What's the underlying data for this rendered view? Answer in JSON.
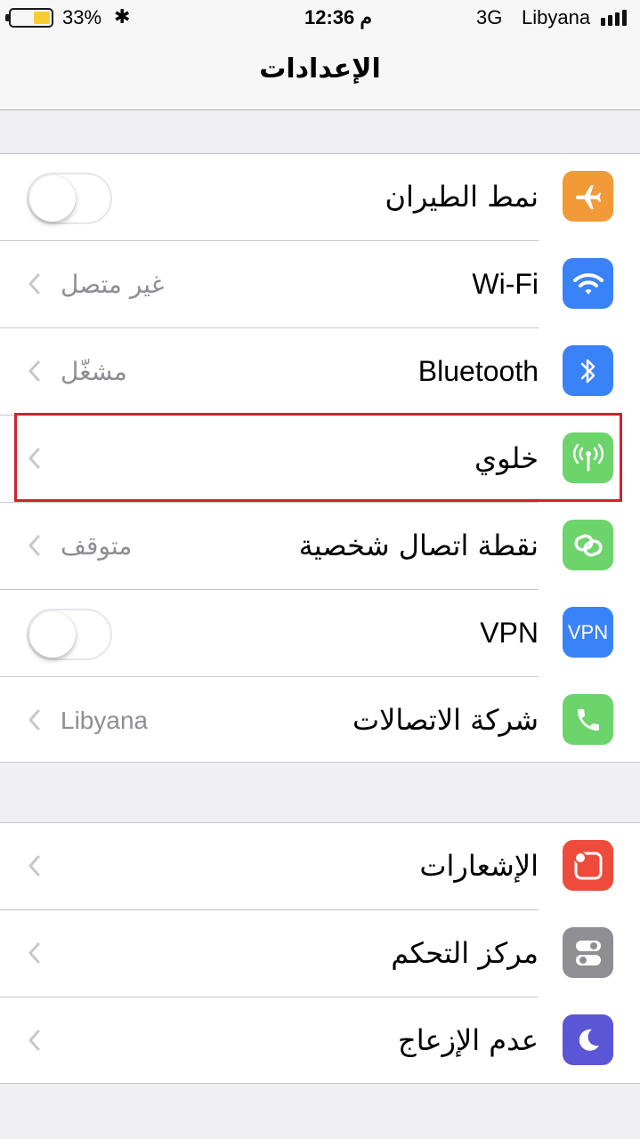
{
  "status_bar": {
    "battery_percent": "33%",
    "battery_level": 0.33,
    "bluetooth_glyph": "✱",
    "time": "12:36 م",
    "network": "3G",
    "carrier": "Libyana",
    "signal_bars": 4
  },
  "nav": {
    "title": "الإعدادات"
  },
  "group1": {
    "rows": [
      {
        "label": "نمط الطيران",
        "icon": "airplane-icon",
        "icon_color": "#f19a37",
        "control": "toggle",
        "toggle_on": false
      },
      {
        "label": "Wi-Fi",
        "value": "غير متصل",
        "icon": "wifi-icon",
        "icon_color": "#3a82f7"
      },
      {
        "label": "Bluetooth",
        "value": "مشغّل",
        "icon": "bluetooth-icon",
        "icon_color": "#3a82f7"
      },
      {
        "label": "خلوي",
        "value": "",
        "icon": "cellular-antenna-icon",
        "icon_color": "#6cd46a"
      },
      {
        "label": "نقطة اتصال شخصية",
        "value": "متوقف",
        "icon": "hotspot-link-icon",
        "icon_color": "#6cd46a"
      },
      {
        "label": "VPN",
        "icon_text": "VPN",
        "icon": "vpn-icon",
        "icon_color": "#3a82f7",
        "control": "toggle",
        "toggle_on": false
      },
      {
        "label": "شركة الاتصالات",
        "value": "Libyana",
        "icon": "phone-icon",
        "icon_color": "#6cd46a"
      }
    ]
  },
  "group2": {
    "rows": [
      {
        "label": "الإشعارات",
        "icon": "notifications-icon",
        "icon_color": "#ee4b3d"
      },
      {
        "label": "مركز التحكم",
        "icon": "control-center-icon",
        "icon_color": "#8e8e93"
      },
      {
        "label": "عدم الإزعاج",
        "icon": "do-not-disturb-moon-icon",
        "icon_color": "#5b56d6"
      }
    ]
  },
  "highlight_color": "#d5202d"
}
